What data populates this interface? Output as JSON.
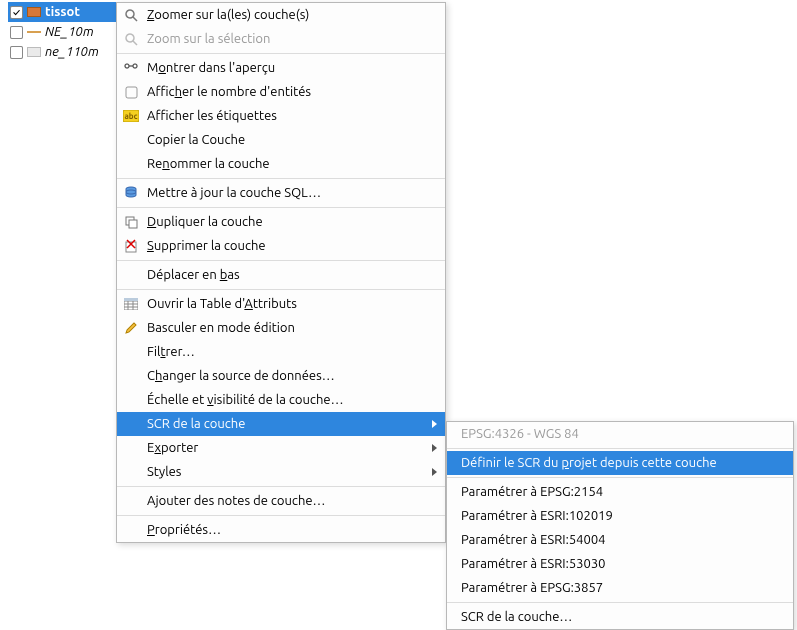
{
  "layers": [
    {
      "name": "tissot",
      "checked": true,
      "selected": true,
      "swatch": "orange"
    },
    {
      "name": "NE_10m",
      "checked": false,
      "selected": false,
      "swatch": "line"
    },
    {
      "name": "ne_110m",
      "checked": false,
      "selected": false,
      "swatch": "gray"
    }
  ],
  "menu": {
    "zoom_to_layer": "Zoomer sur la(les) couche(s)",
    "zoom_to_selection": "Zoom sur la sélection",
    "show_in_overview": "Montrer dans l'aperçu",
    "show_count": "Afficher le nombre d'entités",
    "show_labels": "Afficher les étiquettes",
    "copy_layer": "Copier la Couche",
    "rename_layer": "Renommer la couche",
    "update_sql": "Mettre à jour la couche SQL…",
    "duplicate": "Dupliquer la couche",
    "remove": "Supprimer la couche",
    "move_bottom": "Déplacer en bas",
    "open_attr_table": "Ouvrir la Table d'Attributs",
    "toggle_editing": "Basculer en mode édition",
    "filter": "Filtrer…",
    "change_source": "Changer la source de données…",
    "scale_visibility": "Échelle et visibilité de la couche…",
    "layer_crs": "SCR de la couche",
    "export": "Exporter",
    "styles": "Styles",
    "add_notes": "Ajouter des notes de couche…",
    "properties": "Propriétés…"
  },
  "submenu": {
    "current": "EPSG:4326 - WGS 84",
    "set_project": "Définir le SCR du projet depuis cette couche",
    "set_2154": "Paramétrer à EPSG:2154",
    "set_102019": "Paramétrer à ESRI:102019",
    "set_54004": "Paramétrer à ESRI:54004",
    "set_53030": "Paramétrer à ESRI:53030",
    "set_3857": "Paramétrer à EPSG:3857",
    "layer_crs": "SCR de la couche…"
  }
}
